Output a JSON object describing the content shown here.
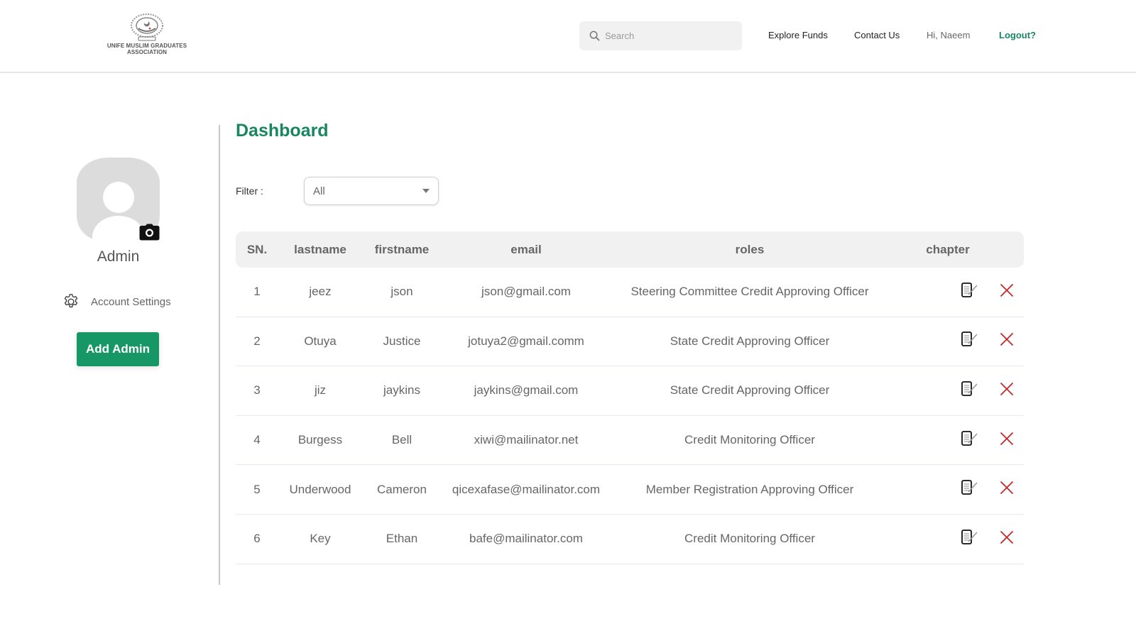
{
  "header": {
    "logo_text_line1": "UNIFE MUSLIM GRADUATES",
    "logo_text_line2": "ASSOCIATION",
    "search_placeholder": "Search",
    "nav": {
      "explore_funds": "Explore Funds",
      "contact_us": "Contact Us",
      "greeting": "Hi, Naeem",
      "logout": "Logout?"
    }
  },
  "sidebar": {
    "profile_name": "Admin",
    "account_settings": "Account Settings",
    "add_admin": "Add Admin"
  },
  "main": {
    "title": "Dashboard",
    "filter_label": "Filter :",
    "filter_value": "All",
    "table": {
      "columns": [
        "SN.",
        "lastname",
        "firstname",
        "email",
        "roles",
        "chapter"
      ],
      "rows": [
        {
          "sn": "1",
          "lastname": "jeez",
          "firstname": "json",
          "email": "json@gmail.com",
          "role": "Steering Committee Credit Approving Officer",
          "chapter": ""
        },
        {
          "sn": "2",
          "lastname": "Otuya",
          "firstname": "Justice",
          "email": "jotuya2@gmail.comm",
          "role": "State Credit Approving Officer",
          "chapter": ""
        },
        {
          "sn": "3",
          "lastname": "jiz",
          "firstname": "jaykins",
          "email": "jaykins@gmail.com",
          "role": "State Credit Approving Officer",
          "chapter": ""
        },
        {
          "sn": "4",
          "lastname": "Burgess",
          "firstname": "Bell",
          "email": "xiwi@mailinator.net",
          "role": "Credit Monitoring Officer",
          "chapter": ""
        },
        {
          "sn": "5",
          "lastname": "Underwood",
          "firstname": "Cameron",
          "email": "qicexafase@mailinator.com",
          "role": "Member Registration Approving Officer",
          "chapter": ""
        },
        {
          "sn": "6",
          "lastname": "Key",
          "firstname": "Ethan",
          "email": "bafe@mailinator.com",
          "role": "Credit Monitoring Officer",
          "chapter": ""
        }
      ]
    }
  },
  "colors": {
    "brand_green": "#18875f",
    "button_green": "#189766",
    "delete_red": "#c62828"
  }
}
